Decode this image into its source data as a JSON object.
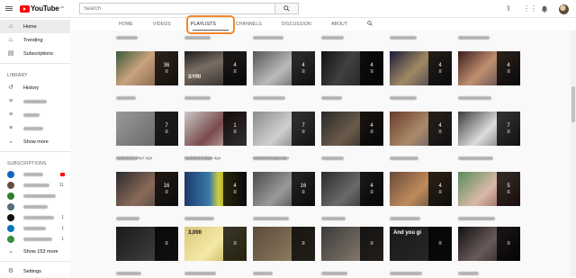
{
  "app": {
    "logo_text": "YouTube",
    "logo_sup": "GB"
  },
  "search": {
    "placeholder": "Search"
  },
  "sidebar": {
    "main": [
      {
        "label": "Home",
        "icon": "home-icon",
        "glyph": "⌂",
        "active": true
      },
      {
        "label": "Trending",
        "icon": "flame-icon",
        "glyph": "♨",
        "active": false
      },
      {
        "label": "Subscriptions",
        "icon": "subscriptions-icon",
        "glyph": "▤",
        "active": false
      }
    ],
    "library_header": "LIBRARY",
    "library": [
      {
        "label": "History",
        "icon": "history-icon",
        "glyph": "↺"
      }
    ],
    "show_more": "Show more",
    "subscriptions_header": "SUBSCRIPTIONS",
    "subscriptions": [
      {
        "color": "#1565c0",
        "count": "",
        "live": true
      },
      {
        "color": "#6d4c41",
        "count": "11",
        "live": false
      },
      {
        "color": "#2e7d32",
        "count": "",
        "live": false
      },
      {
        "color": "#546e7a",
        "count": "",
        "live": false
      },
      {
        "color": "#111111",
        "count": "1",
        "live": false
      },
      {
        "color": "#0277bd",
        "count": "1",
        "live": false
      },
      {
        "color": "#388e3c",
        "count": "1",
        "live": false
      }
    ],
    "show_more_subs": "Show 153 more",
    "settings": "Settings"
  },
  "tabs": [
    {
      "label": "HOME",
      "active": false
    },
    {
      "label": "VIDEOS",
      "active": false
    },
    {
      "label": "PLAYLISTS",
      "active": true
    },
    {
      "label": "CHANNELS",
      "active": false
    },
    {
      "label": "DISCUSSION",
      "active": false
    },
    {
      "label": "ABOUT",
      "active": false
    }
  ],
  "grid": {
    "rows": [
      [
        {
          "count": "36",
          "bg": "linear-gradient(135deg,#3a5a3a,#c9a27e 40%,#5f4a35)"
        },
        {
          "count": "4",
          "bg": "linear-gradient(160deg,#1d1d1d,#7b6d62 40%,#222)",
          "thumb_text": "SYRI"
        },
        {
          "count": "4",
          "bg": "linear-gradient(140deg,#555,#bbb 50%,#444)"
        },
        {
          "count": "4",
          "bg": "linear-gradient(120deg,#111,#404040 40%,#161616)"
        },
        {
          "count": "4",
          "bg": "linear-gradient(135deg,#1b1b3b,#a08a64 45%,#252545)"
        },
        {
          "count": "4",
          "bg": "linear-gradient(135deg,#3b1d1d,#c09070 45%,#2b2b3b)"
        }
      ],
      [
        {
          "count": "7",
          "bg": "linear-gradient(135deg,#9a9a9a,#5a5a5a)",
          "updated": "Updated 2 days ago"
        },
        {
          "count": "1",
          "bg": "linear-gradient(135deg,#c9c9c9,#7a4a4a 50%,#d9d9d9)",
          "updated": "Updated 2 days ago"
        },
        {
          "count": "7",
          "bg": "linear-gradient(135deg,#8a8a8a,#cfcfcf 50%,#5a5a5a)",
          "updated": "Updated 2 days ago"
        },
        {
          "count": "4",
          "bg": "linear-gradient(135deg,#2a2a2a,#6a5a4a 50%,#1a1a1a)"
        },
        {
          "count": "4",
          "bg": "linear-gradient(135deg,#6a3a2a,#aa8a6a 50%,#4a4a5a)"
        },
        {
          "count": "7",
          "bg": "linear-gradient(135deg,#3a3a3a,#dcdcdc 50%,#4a4a4a)"
        }
      ],
      [
        {
          "count": "16",
          "bg": "linear-gradient(135deg,#2a2a2a,#8a6a5a 50%,#3a3a3a)"
        },
        {
          "count": "4",
          "bg": "linear-gradient(90deg,#1a3a6a,#3a7aaa 40%,#cfcf3a 55%,#2a2a2a)"
        },
        {
          "count": "16",
          "bg": "linear-gradient(135deg,#4a4a4a,#9a9a9a 50%,#2a2a2a)"
        },
        {
          "count": "4",
          "bg": "linear-gradient(135deg,#2a2a2a,#6a6a6a 50%,#1a1a1a)"
        },
        {
          "count": "4",
          "bg": "linear-gradient(135deg,#6a4a3a,#bf8a5a 50%,#3a3a3a)"
        },
        {
          "count": "5",
          "bg": "linear-gradient(135deg,#5a8a5a,#d9b9a9 50%,#7a3a3a)"
        }
      ],
      [
        {
          "count": "",
          "bg": "linear-gradient(135deg,#1a1a1a,#4a4a4a)"
        },
        {
          "count": "",
          "bg": "linear-gradient(135deg,#d8c878,#f5e9a8 50%,#aa9a3a)",
          "thumb_text": "3,000"
        },
        {
          "count": "",
          "bg": "linear-gradient(135deg,#5a4a3a,#9a8a6a)"
        },
        {
          "count": "",
          "bg": "linear-gradient(135deg,#3a3a3a,#9a8a7a)"
        },
        {
          "count": "",
          "bg": "linear-gradient(135deg,#1a1a1a,#2a2a2a)",
          "thumb_text": "And you gi"
        },
        {
          "count": "",
          "bg": "linear-gradient(135deg,#111,#6a5a5a 50%,#111)"
        }
      ]
    ]
  },
  "colors": {
    "accent": "#ff0000",
    "highlight": "#f28a2e",
    "text_secondary": "#606060"
  }
}
